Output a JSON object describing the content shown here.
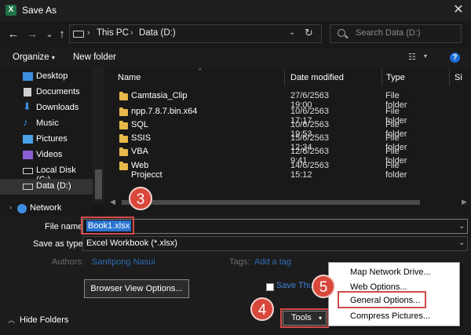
{
  "window": {
    "title": "Save As",
    "app_icon": "X"
  },
  "nav": {
    "back": "←",
    "forward": "→",
    "recent": "⌄",
    "up": "↑",
    "breadcrumb": [
      "This PC",
      "Data (D:)"
    ],
    "search_placeholder": "Search Data (D:)"
  },
  "toolbar": {
    "organize": "Organize",
    "new_folder": "New folder",
    "help": "?"
  },
  "sidebar": {
    "items": [
      {
        "label": "Desktop",
        "icon": "desktop-icon",
        "color": "#3d8ee0"
      },
      {
        "label": "Documents",
        "icon": "documents-icon",
        "color": "#d0d0d0"
      },
      {
        "label": "Downloads",
        "icon": "downloads-icon",
        "color": "#3d8ee0"
      },
      {
        "label": "Music",
        "icon": "music-icon",
        "color": "#3d8ee0"
      },
      {
        "label": "Pictures",
        "icon": "pictures-icon",
        "color": "#4aa3e8"
      },
      {
        "label": "Videos",
        "icon": "videos-icon",
        "color": "#8b5fd6"
      },
      {
        "label": "Local Disk (C:)",
        "icon": "drive-icon",
        "color": "#cfcfcf"
      },
      {
        "label": "Data (D:)",
        "icon": "drive-icon",
        "color": "#cfcfcf"
      },
      {
        "label": "Network",
        "icon": "network-icon",
        "color": "#3d8ee0"
      }
    ]
  },
  "files": {
    "columns": [
      "Name",
      "Date modified",
      "Type",
      "Si"
    ],
    "rows": [
      {
        "name": "Camtasia_Clip",
        "date": "27/6/2563 19:00",
        "type": "File folder"
      },
      {
        "name": "npp.7.8.7.bin.x64",
        "date": "10/6/2563 17:17",
        "type": "File folder"
      },
      {
        "name": "SQL",
        "date": "10/6/2563 19:53",
        "type": "File folder"
      },
      {
        "name": "SSIS",
        "date": "15/6/2563 12:34",
        "type": "File folder"
      },
      {
        "name": "VBA",
        "date": "12/6/2563 9:41",
        "type": "File folder"
      },
      {
        "name": "Web Projecct",
        "date": "14/6/2563 15:12",
        "type": "File folder"
      }
    ]
  },
  "form": {
    "file_name_label": "File name:",
    "file_name_value": "Book1.xlsx",
    "save_type_label": "Save as type:",
    "save_type_value": "Excel Workbook (*.xlsx)",
    "authors_label": "Authors:",
    "authors_value": "Santipong Nasui",
    "tags_label": "Tags:",
    "tags_value": "Add a tag",
    "browser_view": "Browser View Options...",
    "save_thumbnail": "Save Thum",
    "hide_folders": "Hide Folders",
    "tools": "Tools"
  },
  "tools_menu": {
    "items": [
      "Map Network Drive...",
      "Web Options...",
      "General Options...",
      "Compress Pictures..."
    ]
  },
  "badges": {
    "step3": "3",
    "step4": "4",
    "step5": "5"
  },
  "colors": {
    "highlight": "#d64a4a",
    "selection": "#2a74d0",
    "badge": "#d9473b",
    "folder": "#e8b84a"
  }
}
